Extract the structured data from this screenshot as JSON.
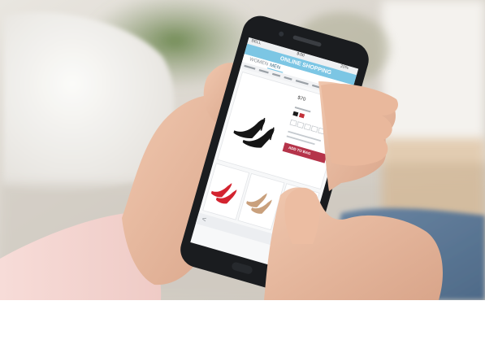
{
  "photo": {
    "subject": "hands holding smartphone showing online shoe shop"
  },
  "phone": {
    "status_bar": {
      "carrier": "BELL",
      "time": "9:00",
      "battery": "20%"
    },
    "app": {
      "title": "ONLINE SHOPPING",
      "category_tabs": [
        "WOMEN",
        "MEN"
      ],
      "featured_product": {
        "price": "$70",
        "button_label": "ADD TO BAG"
      },
      "back_arrow": "<"
    }
  },
  "colors": {
    "app_header": "#7cc6e4",
    "add_button": "#b5344a",
    "phone_body": "#1a1c1f"
  }
}
